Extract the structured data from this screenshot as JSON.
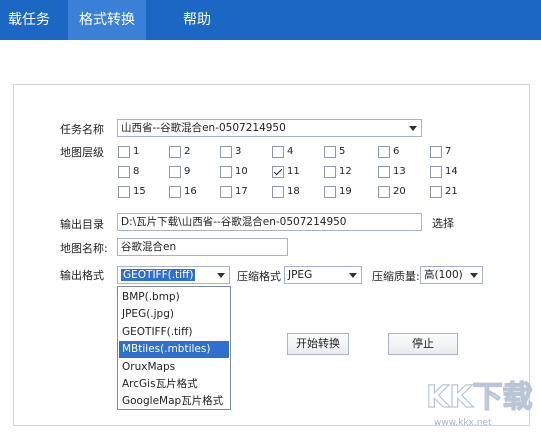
{
  "menu": {
    "tabs": [
      {
        "label": "载任务"
      },
      {
        "label": "格式转换"
      },
      {
        "label": "帮助"
      }
    ]
  },
  "form": {
    "task_name_label": "任务名称",
    "task_name_value": "山西省--谷歌混合en-0507214950",
    "map_level_label": "地图层级",
    "levels": [
      {
        "n": "1",
        "checked": false
      },
      {
        "n": "2",
        "checked": false
      },
      {
        "n": "3",
        "checked": false
      },
      {
        "n": "4",
        "checked": false
      },
      {
        "n": "5",
        "checked": false
      },
      {
        "n": "6",
        "checked": false
      },
      {
        "n": "7",
        "checked": false
      },
      {
        "n": "8",
        "checked": false
      },
      {
        "n": "9",
        "checked": false
      },
      {
        "n": "10",
        "checked": false
      },
      {
        "n": "11",
        "checked": true
      },
      {
        "n": "12",
        "checked": false
      },
      {
        "n": "13",
        "checked": false
      },
      {
        "n": "14",
        "checked": false
      },
      {
        "n": "15",
        "checked": false
      },
      {
        "n": "16",
        "checked": false
      },
      {
        "n": "17",
        "checked": false
      },
      {
        "n": "18",
        "checked": false
      },
      {
        "n": "19",
        "checked": false
      },
      {
        "n": "20",
        "checked": false
      },
      {
        "n": "21",
        "checked": false
      }
    ],
    "output_dir_label": "输出目录",
    "output_dir_value": "D:\\瓦片下载\\山西省--谷歌混合en-0507214950",
    "browse_label": "选择",
    "map_name_label": "地图名称:",
    "map_name_value": "谷歌混合en",
    "output_format_label": "输出格式",
    "output_format_value": "GEOTIFF(.tiff)",
    "compress_format_label": "压缩格式",
    "compress_format_value": "JPEG",
    "compress_quality_label": "压缩质量:",
    "compress_quality_value": "高(100)",
    "start_button": "开始转换",
    "stop_button": "停止"
  },
  "dropdown": {
    "options": [
      "BMP(.bmp)",
      "JPEG(.jpg)",
      "GEOTIFF(.tiff)",
      "MBtiles(.mbtiles)",
      "OruxMaps",
      "ArcGis瓦片格式",
      "GoogleMap瓦片格式"
    ],
    "highlighted_index": 3
  },
  "watermark": {
    "brand": "KK下载",
    "url": "www.kkx.net"
  },
  "colors": {
    "menubar": "#1c67c4",
    "active_tab": "#3a80d6",
    "highlight": "#2f6fd0"
  }
}
